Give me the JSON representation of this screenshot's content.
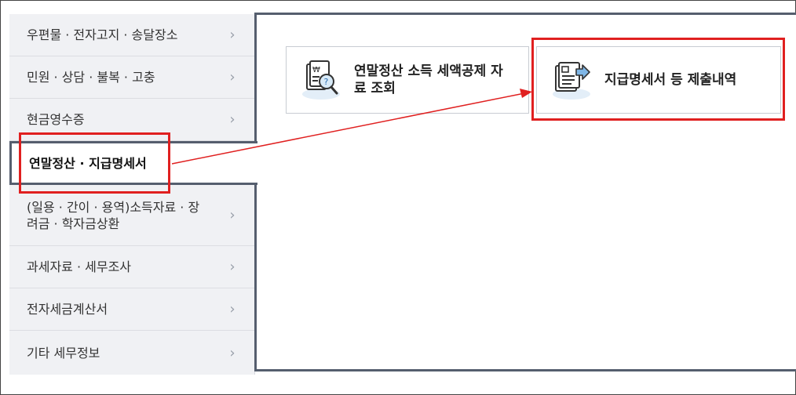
{
  "sidebar": {
    "items": [
      {
        "label": "우편물 · 전자고지 · 송달장소"
      },
      {
        "label": "민원 · 상담 · 불복 · 고충"
      },
      {
        "label": "현금영수증"
      },
      {
        "label": "연말정산 · 지급명세서"
      },
      {
        "label": "(일용 · 간이 · 용역)소득자료 · 장려금 · 학자금상환"
      },
      {
        "label": "과세자료 · 세무조사"
      },
      {
        "label": "전자세금계산서"
      },
      {
        "label": "기타 세무정보"
      }
    ],
    "chevron": "›"
  },
  "panel": {
    "cards": [
      {
        "title": "연말정산 소득 세액공제 자료 조회",
        "icon": "document-search-icon"
      },
      {
        "title": "지급명세서 등 제출내역",
        "icon": "document-submit-icon"
      }
    ]
  },
  "colors": {
    "highlight": "#e02020",
    "active_border": "#555e6e"
  }
}
